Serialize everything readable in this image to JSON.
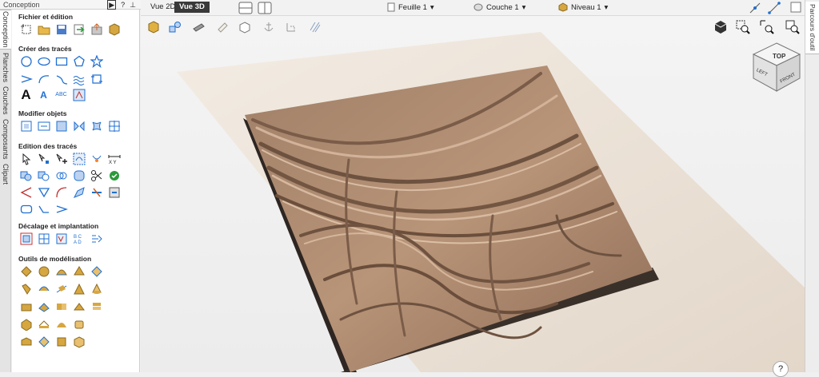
{
  "panel": {
    "title": "Conception",
    "ctrl_toggle": "▶",
    "ctrl_help": "?",
    "ctrl_pin": "⊥"
  },
  "vtabs": [
    "Conception",
    "Planches",
    "Couches",
    "Composants",
    "Clipart"
  ],
  "sections": {
    "fichier": "Fichier et édition",
    "creer": "Créer des tracés",
    "modifier": "Modifier objets",
    "edition": "Edition des tracés",
    "decalage": "Décalage et implantation",
    "outils": "Outils de modélisation"
  },
  "toolbar": {
    "vue2d": "Vue 2D",
    "vue3d": "Vue 3D",
    "feuille": "Feuille 1",
    "couche": "Couche 1",
    "niveau": "Niveau 1",
    "arrow": "▾"
  },
  "viewcube": {
    "top": "TOP",
    "left": "LEFT",
    "front": "FRONT"
  },
  "right_tab": "Parcours d'outil",
  "help": "?",
  "colors": {
    "accent": "#1f6fd1",
    "relief": "#a88670",
    "board": "#ece4da"
  }
}
